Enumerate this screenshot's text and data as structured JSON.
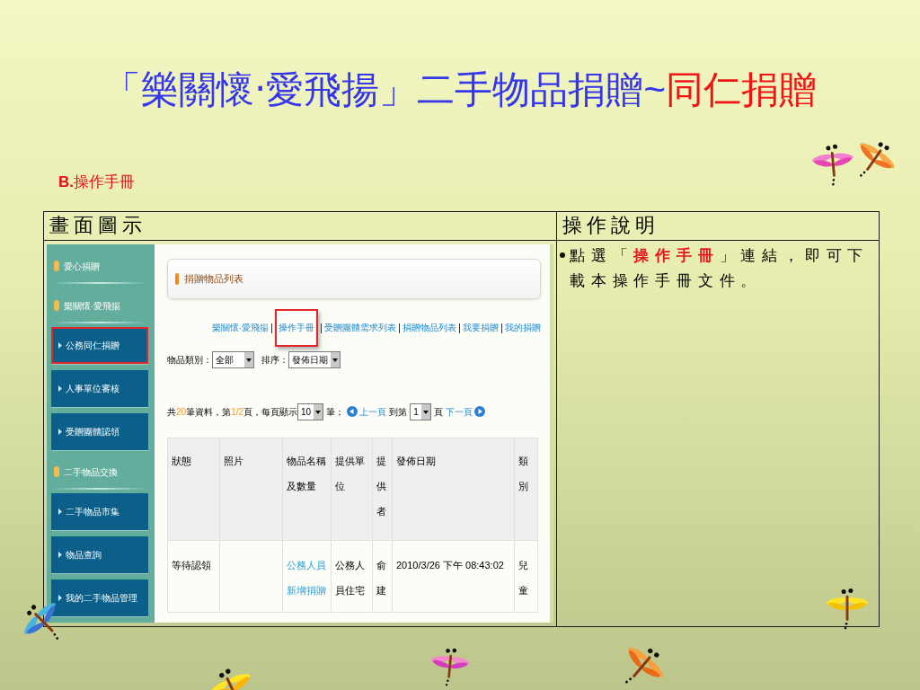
{
  "title": {
    "text": "「樂關懷‧愛飛揚」二手物品捐贈~",
    "highlight": "同仁捐贈"
  },
  "section_heading": "**B.**操作手冊",
  "table": {
    "columns": [
      "畫面圖示",
      "操作說明"
    ],
    "screenshot": {
      "sidebar": {
        "groups": [
          {
            "label": "愛心捐贈"
          },
          {
            "label": "樂關懷‧愛飛揚",
            "items": [
              {
                "label": "公務同仁捐贈",
                "highlighted": true
              },
              {
                "label": "人事單位審核",
                "highlighted": false
              },
              {
                "label": "受贈團體認領",
                "highlighted": false
              }
            ]
          },
          {
            "label": "二手物品交換",
            "items": [
              {
                "label": "二手物品市集",
                "highlighted": false
              },
              {
                "label": "物品查詢",
                "highlighted": false
              },
              {
                "label": "我的二手物品管理",
                "highlighted": false
              }
            ]
          }
        ]
      },
      "panel_title": "捐贈物品列表",
      "links": [
        {
          "label": "樂關懷‧愛飛揚",
          "highlighted": false
        },
        {
          "label": "操作手冊",
          "highlighted": true
        },
        {
          "label": "受贈團體需求列表",
          "highlighted": false
        },
        {
          "label": "捐贈物品列表",
          "highlighted": false
        },
        {
          "label": "我要捐贈",
          "highlighted": false
        },
        {
          "label": "我的捐贈",
          "highlighted": false
        }
      ],
      "filters": [
        {
          "label": "物品類別：",
          "value": "全部"
        },
        {
          "label": "排序：",
          "value": "發佈日期"
        }
      ],
      "pagination": {
        "before_total": "共",
        "total": "20",
        "after_total": "筆資料，第",
        "page": "1/2",
        "after_page": "頁，每頁顯示",
        "per_page": "10",
        "per_page_unit": "筆；",
        "prev": "上一頁",
        "goto_label": "到第",
        "goto_page": "1",
        "goto_unit": "頁",
        "next": "下一頁"
      },
      "list_table": {
        "columns": [
          "狀態",
          "照片",
          "物品名稱及數量",
          "提供單位",
          "提供者",
          "發佈日期",
          "類別"
        ],
        "rows": [
          {
            "status": "等待認領",
            "item": "公務人員新增捐贈",
            "unit": "公務人員住宅",
            "provider": "俞建",
            "date": "2010/3/26 下午 08:43:02",
            "category": "兒童"
          }
        ]
      }
    },
    "description": "點選「**操作手冊**」連結，即可下載本操作手冊文件。"
  }
}
